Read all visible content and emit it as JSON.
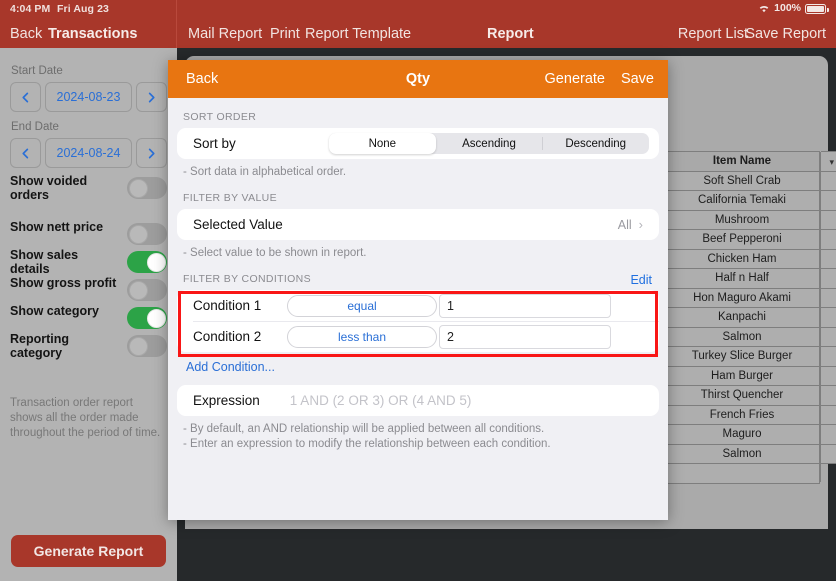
{
  "statusbar": {
    "time": "4:04 PM",
    "date": "Fri Aug 23",
    "battery": "100%",
    "wifi_icon": "wifi-icon",
    "battery_icon": "battery-full-icon"
  },
  "nav": {
    "back": "Back",
    "section_title": "Transactions",
    "mail_report": "Mail Report",
    "print": "Print",
    "report_template": "Report Template",
    "title": "Report",
    "report_list": "Report List",
    "save_report": "Save Report"
  },
  "sidebar": {
    "start_date_label": "Start Date",
    "start_date_value": "2024-08-23",
    "end_date_label": "End Date",
    "end_date_value": "2024-08-24",
    "prev_icon": "chevron-left-icon",
    "next_icon": "chevron-right-icon",
    "options": [
      {
        "label": "Show voided orders",
        "on": false
      },
      {
        "label": "Show nett price",
        "on": false
      },
      {
        "label": "Show sales details",
        "on": true
      },
      {
        "label": "Show gross profit",
        "on": false
      },
      {
        "label": "Show category",
        "on": true
      },
      {
        "label": "Reporting category",
        "on": false
      }
    ],
    "description": "Transaction order report shows all the order made throughout the period of time.",
    "generate_report": "Generate Report"
  },
  "report_table": {
    "header": "Item Name",
    "rows": [
      "Soft Shell Crab",
      "California Temaki",
      "Mushroom",
      "Beef Pepperoni",
      "Chicken Ham",
      "Half n Half",
      "Hon Maguro Akami",
      "Kanpachi",
      "Salmon",
      "Turkey Slice Burger",
      "Ham Burger",
      "Thirst Quencher",
      "French Fries",
      "Maguro",
      "Salmon",
      ""
    ]
  },
  "modal": {
    "back": "Back",
    "title": "Qty",
    "generate": "Generate",
    "save": "Save",
    "sort_order": {
      "header": "SORT ORDER",
      "row_label": "Sort by",
      "options": [
        "None",
        "Ascending",
        "Descending"
      ],
      "selected": "None",
      "note": "- Sort data in alphabetical order."
    },
    "filter_by_value": {
      "header": "FILTER BY VALUE",
      "row_label": "Selected Value",
      "value": "All",
      "chevron_icon": "chevron-right-icon",
      "note": "- Select value to be shown in report."
    },
    "filter_by_conditions": {
      "header": "FILTER BY CONDITIONS",
      "edit": "Edit",
      "conditions": [
        {
          "label": "Condition 1",
          "operator": "equal",
          "value": "1"
        },
        {
          "label": "Condition 2",
          "operator": "less than",
          "value": "2"
        }
      ],
      "add_condition": "Add Condition..."
    },
    "expression": {
      "label": "Expression",
      "placeholder": "1 AND (2 OR 3) OR (4 AND 5)",
      "note_line1": "- By default, an AND relationship will be applied between all conditions.",
      "note_line2": "- Enter an expression to modify the relationship between each condition."
    }
  },
  "colors": {
    "nav_red": "#a8372a",
    "modal_orange": "#e87511",
    "accent_blue": "#2a6fd6",
    "toggle_green": "#2ca347",
    "highlight_red": "#f91616"
  }
}
